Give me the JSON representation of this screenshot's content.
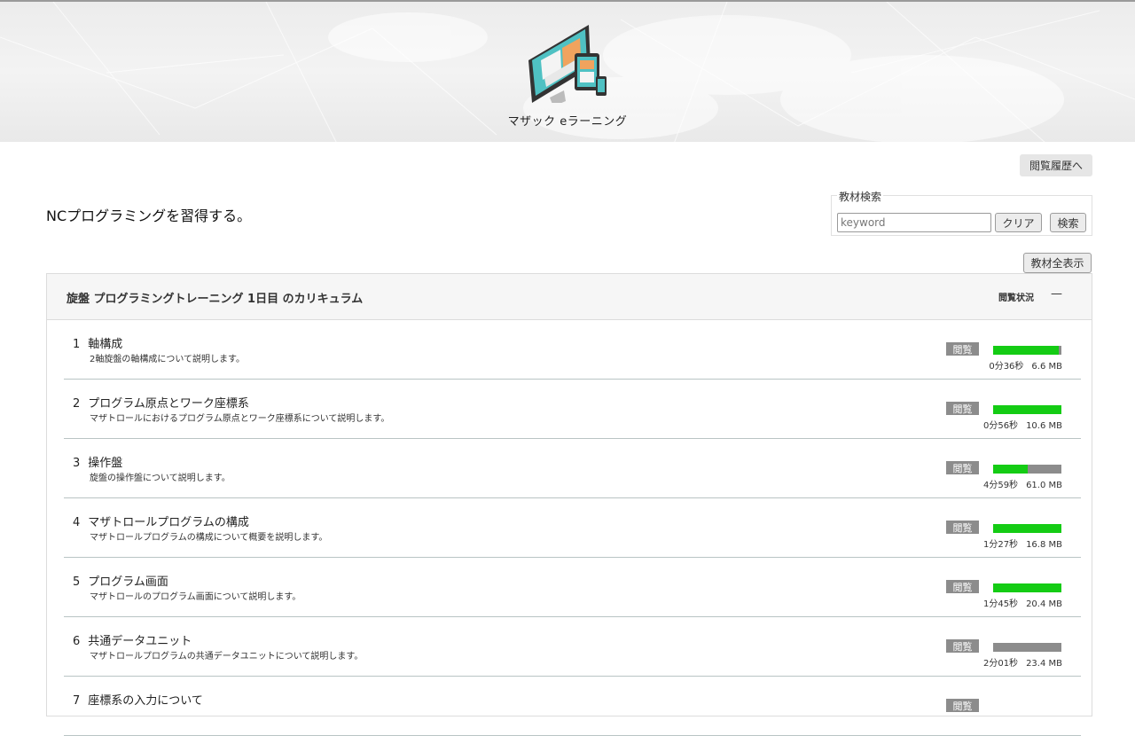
{
  "site": {
    "title": "マザック eラーニング"
  },
  "nav": {
    "history_label": "閲覧履歴へ"
  },
  "page": {
    "heading": "NCプログラミングを習得する。"
  },
  "search": {
    "legend": "教材検索",
    "placeholder": "keyword",
    "clear_label": "クリア",
    "search_label": "検索"
  },
  "show_all_label": "教材全表示",
  "curriculum": {
    "title": "旋盤 プログラミングトレーニング 1日目 のカリキュラム",
    "status_label": "閲覧状況",
    "collapse_symbol": "—",
    "view_label": "閲覧",
    "items": [
      {
        "num": "1",
        "title": "軸構成",
        "desc": "2軸旋盤の軸構成について説明します。",
        "duration": "0分36秒",
        "size": "6.6 MB",
        "progress": 0.96
      },
      {
        "num": "2",
        "title": "プログラム原点とワーク座標系",
        "desc": "マザトロールにおけるプログラム原点とワーク座標系について説明します。",
        "duration": "0分56秒",
        "size": "10.6 MB",
        "progress": 1.0
      },
      {
        "num": "3",
        "title": "操作盤",
        "desc": "旋盤の操作盤について説明します。",
        "duration": "4分59秒",
        "size": "61.0 MB",
        "progress": 0.5
      },
      {
        "num": "4",
        "title": "マザトロールプログラムの構成",
        "desc": "マザトロールプログラムの構成について概要を説明します。",
        "duration": "1分27秒",
        "size": "16.8 MB",
        "progress": 1.0
      },
      {
        "num": "5",
        "title": "プログラム画面",
        "desc": "マザトロールのプログラム画面について説明します。",
        "duration": "1分45秒",
        "size": "20.4 MB",
        "progress": 1.0
      },
      {
        "num": "6",
        "title": "共通データユニット",
        "desc": "マザトロールプログラムの共通データユニットについて説明します。",
        "duration": "2分01秒",
        "size": "23.4 MB",
        "progress": 0.0
      },
      {
        "num": "7",
        "title": "座標系の入力について",
        "desc": "",
        "duration": "",
        "size": "",
        "progress": 0.0
      }
    ]
  },
  "colors": {
    "progress_fill": "#14cc14",
    "progress_track": "#8c8c8c",
    "badge": "#8c8c8c"
  }
}
